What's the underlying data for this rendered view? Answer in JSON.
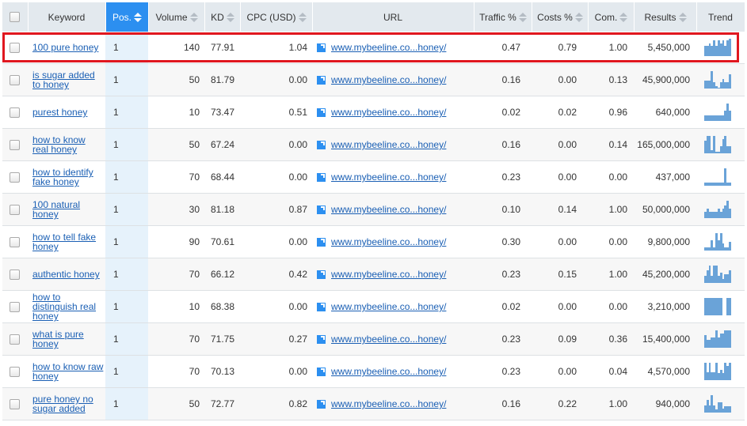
{
  "header": {
    "columns": [
      {
        "key": "select",
        "label": ""
      },
      {
        "key": "keyword",
        "label": "Keyword",
        "sortable": false
      },
      {
        "key": "pos",
        "label": "Pos.",
        "sortable": true,
        "active": true
      },
      {
        "key": "volume",
        "label": "Volume",
        "sortable": true
      },
      {
        "key": "kd",
        "label": "KD",
        "sortable": true
      },
      {
        "key": "cpc",
        "label": "CPC (USD)",
        "sortable": true
      },
      {
        "key": "url",
        "label": "URL",
        "sortable": false
      },
      {
        "key": "traffic",
        "label": "Traffic %",
        "sortable": true
      },
      {
        "key": "costs",
        "label": "Costs %",
        "sortable": true
      },
      {
        "key": "com",
        "label": "Com.",
        "sortable": true
      },
      {
        "key": "results",
        "label": "Results",
        "sortable": true
      },
      {
        "key": "trend",
        "label": "Trend",
        "sortable": false
      }
    ]
  },
  "highlight_color": "#e0171f",
  "accent_color": "#2c8ff0",
  "rows": [
    {
      "keyword": "100 pure honey",
      "pos": "1",
      "volume": "140",
      "kd": "77.91",
      "cpc": "1.04",
      "url": "www.mybeeline.co...honey/",
      "traffic": "0.47",
      "costs": "0.79",
      "com": "1.00",
      "results": "5,450,000",
      "trend": [
        0.6,
        0.6,
        0.75,
        0.6,
        0.9,
        0.6,
        0.9,
        0.75,
        0.9,
        0.6,
        0.9,
        1.0
      ],
      "highlighted": true
    },
    {
      "keyword": "is sugar added to honey",
      "pos": "1",
      "volume": "50",
      "kd": "81.79",
      "cpc": "0.00",
      "url": "www.mybeeline.co...honey/",
      "traffic": "0.16",
      "costs": "0.00",
      "com": "0.13",
      "results": "45,900,000",
      "trend": [
        0.45,
        0.45,
        0.45,
        1.0,
        0.35,
        0.15,
        0.05,
        0.35,
        0.55,
        0.35,
        0.35,
        0.8
      ]
    },
    {
      "keyword": "purest honey",
      "pos": "1",
      "volume": "10",
      "kd": "73.47",
      "cpc": "0.51",
      "url": "www.mybeeline.co...honey/",
      "traffic": "0.02",
      "costs": "0.02",
      "com": "0.96",
      "results": "640,000",
      "trend": [
        0.3,
        0.3,
        0.3,
        0.3,
        0.3,
        0.3,
        0.3,
        0.3,
        0.3,
        0.6,
        1.0,
        0.6
      ]
    },
    {
      "keyword": "how to know real honey",
      "pos": "1",
      "volume": "50",
      "kd": "67.24",
      "cpc": "0.00",
      "url": "www.mybeeline.co...honey/",
      "traffic": "0.16",
      "costs": "0.00",
      "com": "0.14",
      "results": "165,000,000",
      "trend": [
        0.75,
        1.0,
        1.0,
        0.2,
        1.0,
        0.1,
        0.1,
        0.4,
        0.8,
        1.0,
        0.4,
        0.4
      ]
    },
    {
      "keyword": "how to identify fake honey",
      "pos": "1",
      "volume": "70",
      "kd": "68.44",
      "cpc": "0.00",
      "url": "www.mybeeline.co...honey/",
      "traffic": "0.23",
      "costs": "0.00",
      "com": "0.00",
      "results": "437,000",
      "trend": [
        0.2,
        0.2,
        0.2,
        0.2,
        0.2,
        0.2,
        0.2,
        0.2,
        0.2,
        1.0,
        0.2,
        0.2
      ]
    },
    {
      "keyword": "100 natural honey",
      "pos": "1",
      "volume": "30",
      "kd": "81.18",
      "cpc": "0.87",
      "url": "www.mybeeline.co...honey/",
      "traffic": "0.10",
      "costs": "0.14",
      "com": "1.00",
      "results": "50,000,000",
      "trend": [
        0.35,
        0.55,
        0.35,
        0.35,
        0.35,
        0.35,
        0.55,
        0.35,
        0.55,
        0.75,
        1.0,
        0.55
      ]
    },
    {
      "keyword": "how to tell fake honey",
      "pos": "1",
      "volume": "90",
      "kd": "70.61",
      "cpc": "0.00",
      "url": "www.mybeeline.co...honey/",
      "traffic": "0.30",
      "costs": "0.00",
      "com": "0.00",
      "results": "9,800,000",
      "trend": [
        0.2,
        0.2,
        0.2,
        0.6,
        0.2,
        1.0,
        0.6,
        1.0,
        0.4,
        0.2,
        0.2,
        0.5
      ]
    },
    {
      "keyword": "authentic honey",
      "pos": "1",
      "volume": "70",
      "kd": "66.12",
      "cpc": "0.42",
      "url": "www.mybeeline.co...honey/",
      "traffic": "0.23",
      "costs": "0.15",
      "com": "1.00",
      "results": "45,200,000",
      "trend": [
        0.4,
        0.75,
        1.0,
        0.4,
        1.0,
        1.0,
        0.4,
        0.6,
        0.25,
        0.5,
        0.5,
        0.75
      ]
    },
    {
      "keyword": "how to distinguish real honey",
      "pos": "1",
      "volume": "10",
      "kd": "68.38",
      "cpc": "0.00",
      "url": "www.mybeeline.co...honey/",
      "traffic": "0.02",
      "costs": "0.00",
      "com": "0.00",
      "results": "3,210,000",
      "trend": [
        1.0,
        1.0,
        1.0,
        1.0,
        1.0,
        1.0,
        1.0,
        1.0,
        0.0,
        0.0,
        1.0,
        1.0
      ]
    },
    {
      "keyword": "what is pure honey",
      "pos": "1",
      "volume": "70",
      "kd": "71.75",
      "cpc": "0.27",
      "url": "www.mybeeline.co...honey/",
      "traffic": "0.23",
      "costs": "0.09",
      "com": "0.36",
      "results": "15,400,000",
      "trend": [
        0.75,
        0.45,
        0.45,
        0.6,
        0.6,
        1.0,
        0.6,
        0.8,
        0.8,
        1.0,
        1.0,
        1.0
      ]
    },
    {
      "keyword": "how to know raw honey",
      "pos": "1",
      "volume": "70",
      "kd": "70.13",
      "cpc": "0.00",
      "url": "www.mybeeline.co...honey/",
      "traffic": "0.23",
      "costs": "0.00",
      "com": "0.04",
      "results": "4,570,000",
      "trend": [
        1.0,
        0.45,
        1.0,
        0.45,
        0.45,
        1.0,
        0.4,
        0.6,
        0.4,
        1.0,
        0.8,
        1.0
      ]
    },
    {
      "keyword": "pure honey no sugar added",
      "pos": "1",
      "volume": "50",
      "kd": "72.77",
      "cpc": "0.82",
      "url": "www.mybeeline.co...honey/",
      "traffic": "0.16",
      "costs": "0.22",
      "com": "1.00",
      "results": "940,000",
      "trend": [
        0.4,
        0.75,
        0.4,
        1.0,
        0.4,
        0.2,
        0.6,
        0.6,
        0.25,
        0.35,
        0.35,
        0.35
      ]
    }
  ]
}
